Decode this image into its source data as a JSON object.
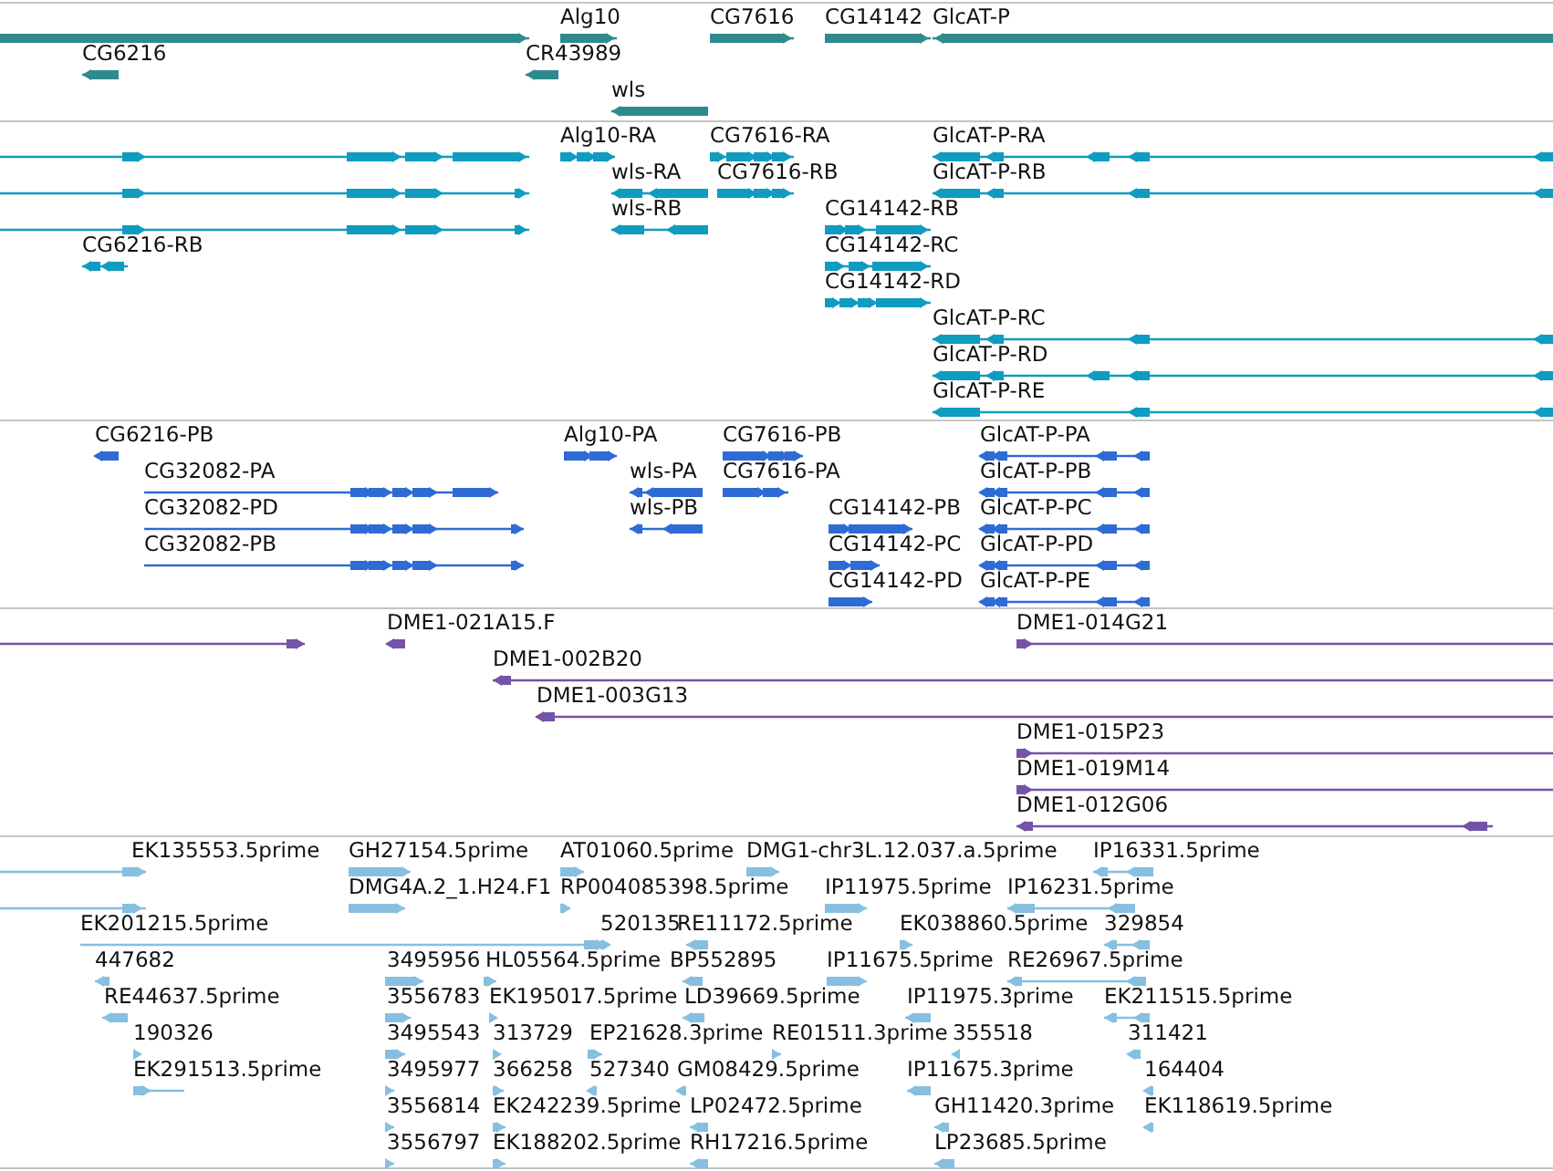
{
  "tracks": [
    {
      "kind": "gene",
      "features": [
        {
          "label": "Alg10"
        },
        {
          "label": "CG7616"
        },
        {
          "label": "CG14142"
        },
        {
          "label": "GlcAT-P"
        },
        {
          "label": "CG6216"
        },
        {
          "label": "CR43989"
        },
        {
          "label": "wls"
        }
      ]
    },
    {
      "kind": "transcript",
      "features": [
        {
          "label": "Alg10-RA"
        },
        {
          "label": "CG7616-RA"
        },
        {
          "label": "GlcAT-P-RA"
        },
        {
          "label": "wls-RA"
        },
        {
          "label": "CG7616-RB"
        },
        {
          "label": "GlcAT-P-RB"
        },
        {
          "label": "wls-RB"
        },
        {
          "label": "CG14142-RB"
        },
        {
          "label": "CG6216-RB"
        },
        {
          "label": "CG14142-RC"
        },
        {
          "label": "CG14142-RD"
        },
        {
          "label": "GlcAT-P-RC"
        },
        {
          "label": "GlcAT-P-RD"
        },
        {
          "label": "GlcAT-P-RE"
        }
      ]
    },
    {
      "kind": "protein",
      "features": [
        {
          "label": "CG6216-PB"
        },
        {
          "label": "Alg10-PA"
        },
        {
          "label": "CG7616-PB"
        },
        {
          "label": "GlcAT-P-PA"
        },
        {
          "label": "CG32082-PA"
        },
        {
          "label": "wls-PA"
        },
        {
          "label": "CG7616-PA"
        },
        {
          "label": "GlcAT-P-PB"
        },
        {
          "label": "CG32082-PD"
        },
        {
          "label": "wls-PB"
        },
        {
          "label": "CG14142-PB"
        },
        {
          "label": "GlcAT-P-PC"
        },
        {
          "label": "CG32082-PB"
        },
        {
          "label": "CG14142-PC"
        },
        {
          "label": "GlcAT-P-PD"
        },
        {
          "label": "CG14142-PD"
        },
        {
          "label": "GlcAT-P-PE"
        }
      ]
    },
    {
      "kind": "clone",
      "features": [
        {
          "label": "DME1-021A15.F"
        },
        {
          "label": "DME1-014G21"
        },
        {
          "label": "DME1-002B20"
        },
        {
          "label": "DME1-003G13"
        },
        {
          "label": "DME1-015P23"
        },
        {
          "label": "DME1-019M14"
        },
        {
          "label": "DME1-012G06"
        }
      ]
    },
    {
      "kind": "est",
      "features": [
        {
          "label": "EK135553.5prime"
        },
        {
          "label": "GH27154.5prime"
        },
        {
          "label": "AT01060.5prime"
        },
        {
          "label": "DMG1-chr3L.12.037.a.5prime"
        },
        {
          "label": "IP16331.5prime"
        },
        {
          "label": "DMG4A.2_1.H24.F1"
        },
        {
          "label": "RP004085398.5prime"
        },
        {
          "label": "IP11975.5prime"
        },
        {
          "label": "IP16231.5prime"
        },
        {
          "label": "EK201215.5prime"
        },
        {
          "label": "520135"
        },
        {
          "label": "RE11172.5prime"
        },
        {
          "label": "EK038860.5prime"
        },
        {
          "label": "329854"
        },
        {
          "label": "447682"
        },
        {
          "label": "3495956"
        },
        {
          "label": "HL05564.5prime"
        },
        {
          "label": "BP552895"
        },
        {
          "label": "IP11675.5prime"
        },
        {
          "label": "RE26967.5prime"
        },
        {
          "label": "RE44637.5prime"
        },
        {
          "label": "3556783"
        },
        {
          "label": "EK195017.5prime"
        },
        {
          "label": "LD39669.5prime"
        },
        {
          "label": "IP11975.3prime"
        },
        {
          "label": "EK211515.5prime"
        },
        {
          "label": "190326"
        },
        {
          "label": "3495543"
        },
        {
          "label": "313729"
        },
        {
          "label": "EP21628.3prime"
        },
        {
          "label": "RE01511.3prime"
        },
        {
          "label": "355518"
        },
        {
          "label": "311421"
        },
        {
          "label": "EK291513.5prime"
        },
        {
          "label": "3495977"
        },
        {
          "label": "366258"
        },
        {
          "label": "527340"
        },
        {
          "label": "GM08429.5prime"
        },
        {
          "label": "IP11675.3prime"
        },
        {
          "label": "164404"
        },
        {
          "label": "3556814"
        },
        {
          "label": "EK242239.5prime"
        },
        {
          "label": "LP02472.5prime"
        },
        {
          "label": "GH11420.3prime"
        },
        {
          "label": "EK118619.5prime"
        },
        {
          "label": "3556797"
        },
        {
          "label": "EK188202.5prime"
        },
        {
          "label": "RH17216.5prime"
        },
        {
          "label": "LP23685.5prime"
        }
      ]
    }
  ]
}
